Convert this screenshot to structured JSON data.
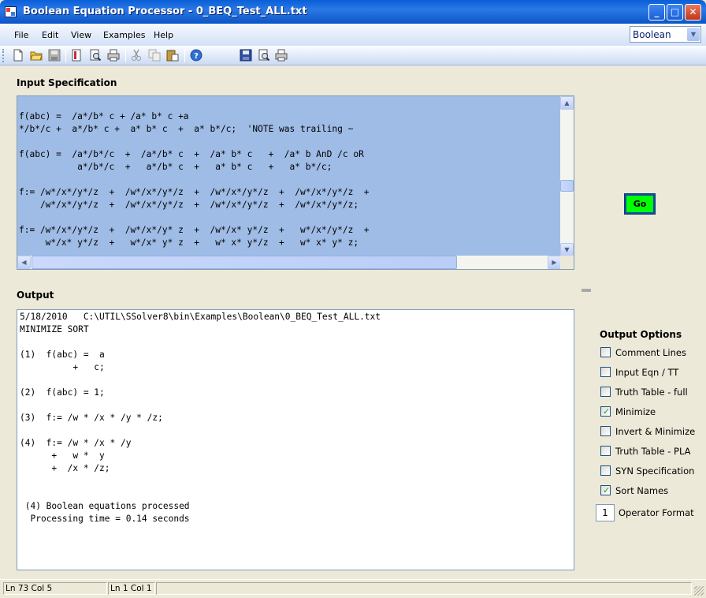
{
  "window": {
    "title": "Boolean Equation Processor - 0_BEQ_Test_ALL.txt"
  },
  "menu": {
    "file": "File",
    "edit": "Edit",
    "view": "View",
    "examples": "Examples",
    "help": "Help"
  },
  "mode_select": {
    "value": "Boolean"
  },
  "toolbar": {
    "icons": [
      "new-file-icon",
      "open-folder-icon",
      "save-icon",
      "print-preview-icon",
      "find-icon",
      "print-icon",
      "cut-icon",
      "copy-icon",
      "paste-icon",
      "help-icon",
      "save-output-icon",
      "preview-output-icon",
      "print-output-icon"
    ]
  },
  "input": {
    "label": "Input Specification",
    "text": "\nf(abc) =  /a*/b* c + /a* b* c +a\n*/b*/c +  a*/b* c +  a* b* c  +  a* b*/c;  'NOTE was trailing ~\n\nf(abc) =  /a*/b*/c  +  /a*/b* c  +  /a* b* c   +  /a* b AnD /c oR\n           a*/b*/c  +   a*/b* c  +   a* b* c   +   a* b*/c;\n\nf:= /w*/x*/y*/z  +  /w*/x*/y*/z  +  /w*/x*/y*/z  +  /w*/x*/y*/z  +\n    /w*/x*/y*/z  +  /w*/x*/y*/z  +  /w*/x*/y*/z  +  /w*/x*/y*/z;\n\nf:= /w*/x*/y*/z  +  /w*/x*/y* z  +  /w*/x* y*/z  +   w*/x*/y*/z  +\n     w*/x* y*/z  +   w*/x* y* z  +   w* x* y*/z  +   w* x* y* z;"
  },
  "go_button": {
    "label": "Go"
  },
  "output": {
    "label": "Output",
    "text": "5/18/2010   C:\\UTIL\\SSolver8\\bin\\Examples\\Boolean\\0_BEQ_Test_ALL.txt\nMINIMIZE SORT\n\n(1)  f(abc) =  a\n          +   c;\n\n(2)  f(abc) = 1;\n\n(3)  f:= /w * /x * /y * /z;\n\n(4)  f:= /w * /x * /y\n      +   w *  y\n      +  /x * /z;\n\n\n (4) Boolean equations processed\n  Processing time = 0.14 seconds"
  },
  "options": {
    "title": "Output Options",
    "items": [
      {
        "label": "Comment Lines",
        "checked": false
      },
      {
        "label": "Input Eqn / TT",
        "checked": false
      },
      {
        "label": "Truth Table - full",
        "checked": false
      },
      {
        "label": "Minimize",
        "checked": true
      },
      {
        "label": "Invert & Minimize",
        "checked": false
      },
      {
        "label": "Truth Table - PLA",
        "checked": false
      },
      {
        "label": "SYN Specification",
        "checked": false
      },
      {
        "label": "Sort Names",
        "checked": true
      }
    ],
    "operator_format": {
      "value": "1",
      "label": "Operator Format"
    }
  },
  "status": {
    "input_pos": "Ln 73   Col 5",
    "output_pos": "Ln 1   Col 1"
  }
}
